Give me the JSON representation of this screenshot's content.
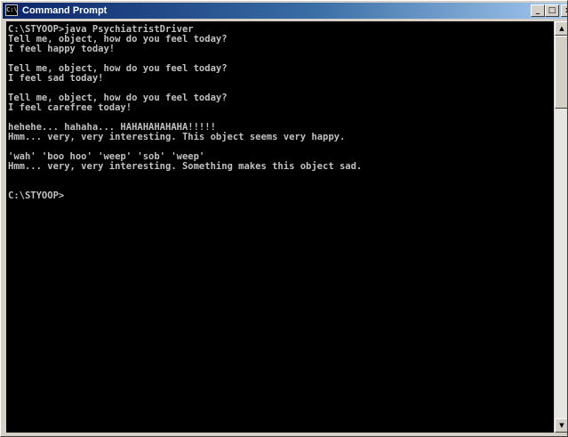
{
  "window": {
    "title": "Command Prompt",
    "icon": "console-icon",
    "buttons": {
      "minimize": "_",
      "maximize": "□",
      "close": "x"
    }
  },
  "console": {
    "text_color": "#c0c0c0",
    "background_color": "#000000",
    "lines": [
      "C:\\STYOOP>java PsychiatristDriver",
      "Tell me, object, how do you feel today?",
      "I feel happy today!",
      "",
      "Tell me, object, how do you feel today?",
      "I feel sad today!",
      "",
      "Tell me, object, how do you feel today?",
      "I feel carefree today!",
      "",
      "hehehe... hahaha... HAHAHAHAHAHA!!!!!",
      "Hmm... very, very interesting. This object seems very happy.",
      "",
      "'wah' 'boo hoo' 'weep' 'sob' 'weep'",
      "Hmm... very, very interesting. Something makes this object sad.",
      "",
      "",
      "C:\\STYOOP>"
    ]
  },
  "scrollbar": {
    "up_arrow": "▲",
    "down_arrow": "▼"
  }
}
